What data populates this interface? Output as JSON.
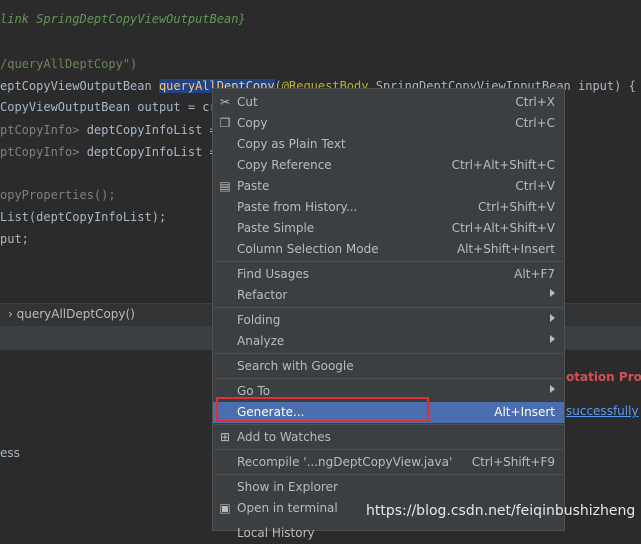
{
  "editor": {
    "lines": [
      {
        "parts": [
          {
            "t": "link",
            "c": "link"
          },
          {
            "t": " SpringDeptCopyViewOutputBean}",
            "c": "doc"
          }
        ]
      },
      {
        "parts": [
          {
            "t": "/queryAllDeptCopy\")",
            "c": "str"
          }
        ]
      },
      {
        "parts": [
          {
            "t": "eptCopyViewOutputBean ",
            "c": "param"
          },
          {
            "t": "queryAllDeptCopy",
            "c": "fn selword"
          },
          {
            "t": "(",
            "c": "param"
          },
          {
            "t": "@RequestBody",
            "c": "ann"
          },
          {
            "t": " SpringDeptCopyViewInputBean input) {",
            "c": "param"
          }
        ]
      },
      {
        "parts": [
          {
            "t": "CopyViewOutputBean output = cre",
            "c": "param"
          }
        ]
      },
      {
        "parts": [
          {
            "t": "ptCopyInfo> ",
            "c": "grey"
          },
          {
            "t": "deptCopyInfoList = r",
            "c": "param"
          }
        ]
      },
      {
        "parts": [
          {
            "t": "ptCopyInfo> ",
            "c": "grey"
          },
          {
            "t": "deptCopyInfoList = d",
            "c": "param"
          }
        ]
      },
      {
        "parts": [
          {
            "t": "opyProperties();",
            "c": "grey"
          }
        ]
      },
      {
        "parts": [
          {
            "t": "List(deptCopyInfoList);",
            "c": "param"
          }
        ]
      },
      {
        "parts": [
          {
            "t": "put;",
            "c": "param"
          }
        ]
      }
    ]
  },
  "breadcrumb": {
    "method": "queryAllDeptCopy()"
  },
  "bottom": {
    "annotation_title": "otation Proc",
    "success_link": "successfully",
    "side_text": "ess"
  },
  "menu": {
    "items": [
      {
        "label": "Cut",
        "shortcut": "Ctrl+X",
        "icon": "✂",
        "icon_name": "cut-icon"
      },
      {
        "label": "Copy",
        "shortcut": "Ctrl+C",
        "icon": "❐",
        "icon_name": "copy-icon"
      },
      {
        "label": "Copy as Plain Text",
        "shortcut": "",
        "icon": "",
        "icon_name": ""
      },
      {
        "label": "Copy Reference",
        "shortcut": "Ctrl+Alt+Shift+C",
        "icon": "",
        "icon_name": ""
      },
      {
        "label": "Paste",
        "shortcut": "Ctrl+V",
        "icon": "▤",
        "icon_name": "paste-icon"
      },
      {
        "label": "Paste from History...",
        "shortcut": "Ctrl+Shift+V",
        "icon": "",
        "icon_name": ""
      },
      {
        "label": "Paste Simple",
        "shortcut": "Ctrl+Alt+Shift+V",
        "icon": "",
        "icon_name": ""
      },
      {
        "label": "Column Selection Mode",
        "shortcut": "Alt+Shift+Insert",
        "icon": "",
        "icon_name": ""
      },
      {
        "label": "Find Usages",
        "shortcut": "Alt+F7",
        "icon": "",
        "icon_name": ""
      },
      {
        "label": "Refactor",
        "shortcut": "",
        "icon": "",
        "icon_name": "",
        "submenu": true
      },
      {
        "label": "Folding",
        "shortcut": "",
        "icon": "",
        "icon_name": "",
        "submenu": true
      },
      {
        "label": "Analyze",
        "shortcut": "",
        "icon": "",
        "icon_name": "",
        "submenu": true
      },
      {
        "label": "Search with Google",
        "shortcut": "",
        "icon": "",
        "icon_name": ""
      },
      {
        "label": "Go To",
        "shortcut": "",
        "icon": "",
        "icon_name": "",
        "submenu": true
      },
      {
        "label": "Generate...",
        "shortcut": "Alt+Insert",
        "icon": "",
        "icon_name": "",
        "active": true
      },
      {
        "label": "Add to Watches",
        "shortcut": "",
        "icon": "⊞",
        "icon_name": "watches-icon"
      },
      {
        "label": "Recompile '...ngDeptCopyView.java'",
        "shortcut": "Ctrl+Shift+F9",
        "icon": "",
        "icon_name": ""
      },
      {
        "label": "Show in Explorer",
        "shortcut": "",
        "icon": "",
        "icon_name": ""
      },
      {
        "label": "Open in terminal",
        "shortcut": "",
        "icon": "▣",
        "icon_name": "terminal-icon"
      },
      {
        "label": "Local History",
        "shortcut": "",
        "icon": "",
        "icon_name": ""
      }
    ]
  },
  "watermark": "https://blog.csdn.net/feiqinbushizheng"
}
